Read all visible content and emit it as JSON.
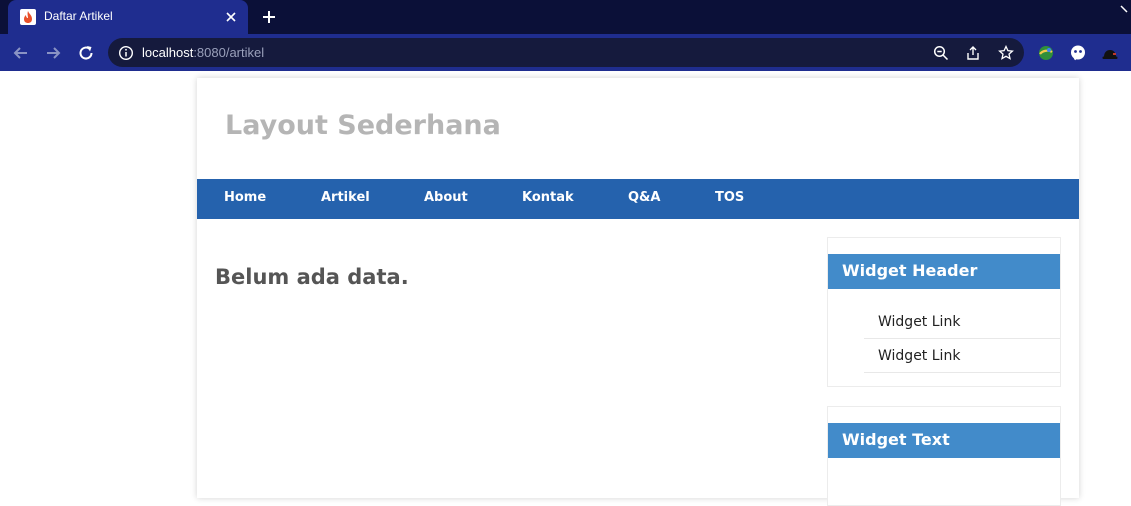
{
  "browser": {
    "tab": {
      "title": "Daftar Artikel"
    },
    "address": {
      "host": "localhost",
      "rest": ":8080/artikel"
    }
  },
  "site": {
    "title": "Layout Sederhana",
    "nav": [
      "Home",
      "Artikel",
      "About",
      "Kontak",
      "Q&A",
      "TOS"
    ],
    "main": {
      "message": "Belum ada data."
    },
    "widgets": [
      {
        "header": "Widget Header",
        "links": [
          "Widget Link",
          "Widget Link"
        ]
      },
      {
        "header": "Widget Text"
      }
    ]
  },
  "colors": {
    "tabstrip": "#0b1038",
    "toolbar": "#1f2d8f",
    "nav_bar": "#2562ad",
    "widget_header": "#428bca",
    "site_title": "#b5b5b5"
  },
  "icons": [
    "codeigniter-flame-icon",
    "close-icon",
    "plus-icon",
    "back-arrow-icon",
    "forward-arrow-icon",
    "reload-icon",
    "info-icon",
    "zoom-icon",
    "share-icon",
    "star-icon",
    "extension-globe-icon",
    "extension-chat-icon",
    "extension-hat-icon"
  ]
}
